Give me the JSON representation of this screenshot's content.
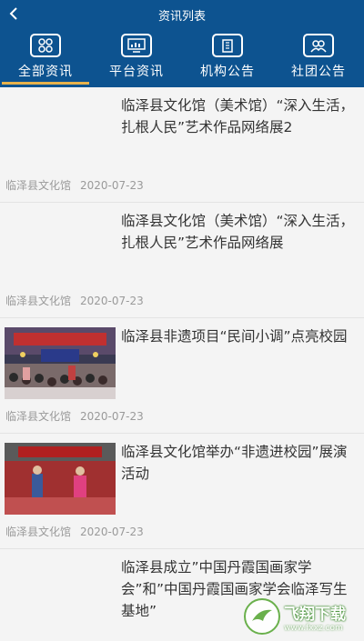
{
  "header": {
    "title": "资讯列表",
    "back_icon": "chevron-left-icon"
  },
  "tabs": [
    {
      "label": "全部资讯",
      "icon": "grid-icon",
      "active": true
    },
    {
      "label": "平台资讯",
      "icon": "monitor-chart-icon",
      "active": false
    },
    {
      "label": "机构公告",
      "icon": "building-icon",
      "active": false
    },
    {
      "label": "社团公告",
      "icon": "group-icon",
      "active": false
    }
  ],
  "news": [
    {
      "title": "临泽县文化馆（美术馆）“深入生活，扎根人民”艺术作品网络展2",
      "source": "临泽县文化馆",
      "date": "2020-07-23",
      "thumb": ""
    },
    {
      "title": "临泽县文化馆（美术馆）“深入生活，扎根人民”艺术作品网络展",
      "source": "临泽县文化馆",
      "date": "2020-07-23",
      "thumb": ""
    },
    {
      "title": "临泽县非遗项目“民间小调”点亮校园",
      "source": "临泽县文化馆",
      "date": "2020-07-23",
      "thumb": "stage-performance-photo"
    },
    {
      "title": "临泽县文化馆举办“非遗进校园”展演活动",
      "source": "临泽县文化馆",
      "date": "2020-07-23",
      "thumb": "school-performance-photo"
    },
    {
      "title": "临泽县成立”中国丹霞国画家学会”和”中国丹霞国画家学会临泽写生基地”",
      "source": "",
      "date": "",
      "thumb": ""
    }
  ],
  "watermark": {
    "text": "飞翔下载",
    "url": "www.fxxz.com"
  },
  "colors": {
    "header_bg": "#0d5390",
    "active_underline": "#e7b24c",
    "page_bg": "#f4f4f4"
  }
}
